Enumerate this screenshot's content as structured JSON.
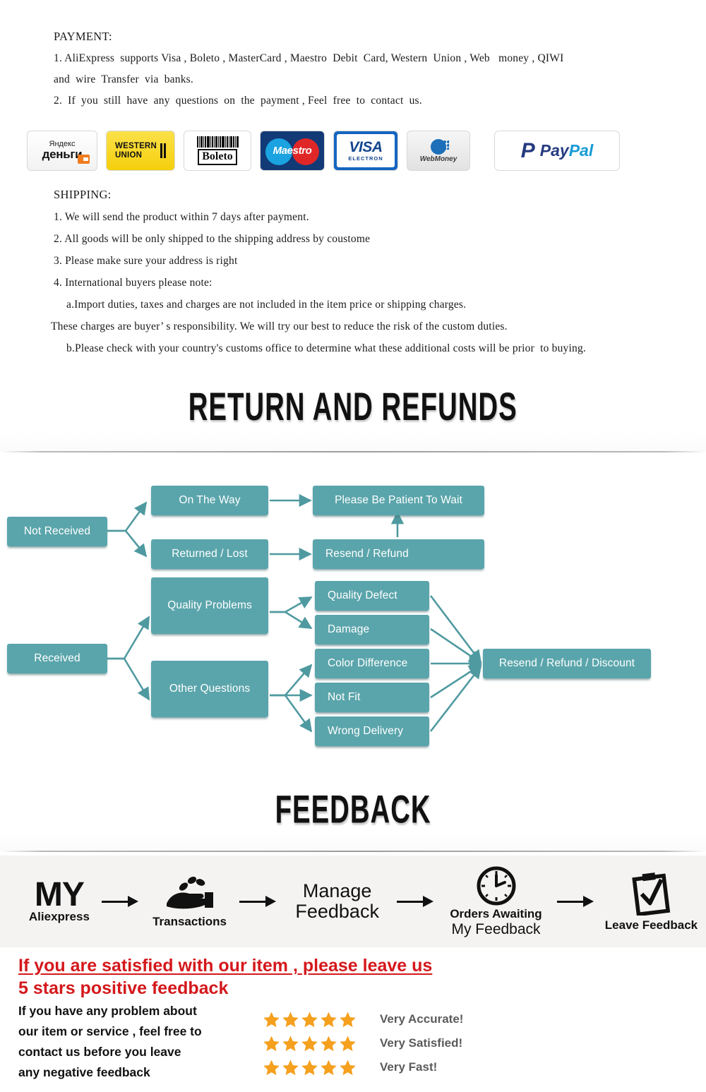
{
  "payment": {
    "heading": "PAYMENT:",
    "lines": [
      "1. AliExpress  supports Visa , Boleto , MasterCard , Maestro  Debit  Card, Western  Union , Web   money , QIWI",
      "and  wire  Transfer  via  banks.",
      "2.  If  you  still  have  any  questions  on  the  payment , Feel  free  to  contact  us."
    ],
    "logos": [
      {
        "name": "yandex-money-logo",
        "top": "Яндекс",
        "bottom": "деньги"
      },
      {
        "name": "western-union-logo",
        "line1": "WESTERN",
        "line2": "UNION"
      },
      {
        "name": "boleto-logo",
        "label": "Boleto"
      },
      {
        "name": "maestro-logo",
        "label": "Maestro"
      },
      {
        "name": "visa-electron-logo",
        "word": "VISA",
        "sub": "ELECTRON"
      },
      {
        "name": "webmoney-logo",
        "label": "WebMoney"
      },
      {
        "name": "paypal-logo",
        "mark": "P",
        "word_a": "Pay",
        "word_b": "Pal"
      }
    ]
  },
  "shipping": {
    "heading": "SHIPPING:",
    "lines": [
      "1. We will send the product within 7 days after payment.",
      "2. All goods will be only shipped to the shipping address by coustome",
      "3. Please make sure your address is right",
      "4. International buyers please note:",
      "a.Import duties, taxes and charges are not included in the item price or shipping charges.",
      "These charges are buyer’ s responsibility. We will try our best to reduce the risk of the custom duties.",
      "b.Please check with your country's customs office to determine what these additional costs will be prior  to buying."
    ]
  },
  "returns": {
    "banner_title": "RETURN AND REFUNDS",
    "box_color": "#5aa5ab",
    "boxes": [
      {
        "id": "not-received",
        "label": "Not Received"
      },
      {
        "id": "on-the-way",
        "label": "On The Way"
      },
      {
        "id": "returned-lost",
        "label": "Returned / Lost"
      },
      {
        "id": "please-be-patient",
        "label": "Please Be Patient To Wait"
      },
      {
        "id": "resend-refund",
        "label": "Resend / Refund"
      },
      {
        "id": "received",
        "label": "Received"
      },
      {
        "id": "quality-problems",
        "label": "Quality Problems"
      },
      {
        "id": "other-questions",
        "label": "Other Questions"
      },
      {
        "id": "quality-defect",
        "label": "Quality Defect"
      },
      {
        "id": "damage",
        "label": "Damage"
      },
      {
        "id": "color-difference",
        "label": "Color Difference"
      },
      {
        "id": "not-fit",
        "label": "Not Fit"
      },
      {
        "id": "wrong-delivery",
        "label": "Wrong Delivery"
      },
      {
        "id": "resend-refund-discount",
        "label": "Resend / Refund / Discount"
      }
    ]
  },
  "feedback": {
    "banner_title": "FEEDBACK",
    "steps": [
      {
        "icon": "my-aliexpress-icon",
        "big": "MY",
        "caption": "Aliexpress"
      },
      {
        "icon": "hand-coins-icon",
        "caption": "Transactions"
      },
      {
        "icon": "manage-feedback-text",
        "line1": "Manage",
        "line2": "Feedback"
      },
      {
        "icon": "clock-icon",
        "caption": "Orders Awaiting\nMy Feedback",
        "caption_l1": "Orders Awaiting",
        "caption_l2": "My Feedback"
      },
      {
        "icon": "clipboard-check-icon",
        "caption": "Leave Feedback"
      }
    ],
    "headline_color": "#d4181c",
    "headline_line1": "If you are satisfied with our item , please leave us",
    "headline_line2": "5 stars positive feedback",
    "note_lines": [
      "If you have any problem about",
      "our item or service , feel free to",
      "contact us before you  leave",
      "any negative feedback"
    ],
    "star_color": "#f5a01e",
    "ratings": [
      {
        "stars": 5,
        "label": "Very Accurate!"
      },
      {
        "stars": 5,
        "label": "Very Satisfied!"
      },
      {
        "stars": 5,
        "label": "Very Fast!"
      }
    ]
  }
}
